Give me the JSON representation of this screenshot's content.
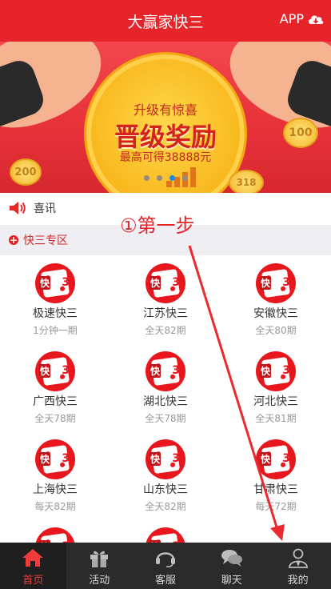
{
  "header": {
    "title": "大赢家快三",
    "app_label": "APP"
  },
  "banner": {
    "line1": "升级有惊喜",
    "line2": "晋级奖励",
    "line3": "最高可得38888元",
    "coins": [
      "200",
      "100",
      "318"
    ],
    "slide_count": 4,
    "active_slide": 3
  },
  "notice": {
    "text": "喜讯"
  },
  "section": {
    "title": "快三专区"
  },
  "games": [
    {
      "name": "极速快三",
      "period": "1分钟一期"
    },
    {
      "name": "江苏快三",
      "period": "全天82期"
    },
    {
      "name": "安徽快三",
      "period": "全天80期"
    },
    {
      "name": "广西快三",
      "period": "全天78期"
    },
    {
      "name": "湖北快三",
      "period": "全天78期"
    },
    {
      "name": "河北快三",
      "period": "全天81期"
    },
    {
      "name": "上海快三",
      "period": "每天82期"
    },
    {
      "name": "山东快三",
      "period": "全天82期"
    },
    {
      "name": "甘肃快三",
      "period": "每天72期"
    }
  ],
  "logo_text": {
    "kuai": "快",
    "three": "3"
  },
  "annotation": {
    "text": "①第一步"
  },
  "tabbar": {
    "items": [
      {
        "label": "首页",
        "icon": "home-icon"
      },
      {
        "label": "活动",
        "icon": "gift-icon"
      },
      {
        "label": "客服",
        "icon": "headset-icon"
      },
      {
        "label": "聊天",
        "icon": "chat-icon"
      },
      {
        "label": "我的",
        "icon": "user-icon"
      }
    ],
    "active_index": 0
  },
  "colors": {
    "brand_red": "#e8242b",
    "tabbar_bg": "#2b2b2b",
    "active_tab": "#f13b3b"
  }
}
